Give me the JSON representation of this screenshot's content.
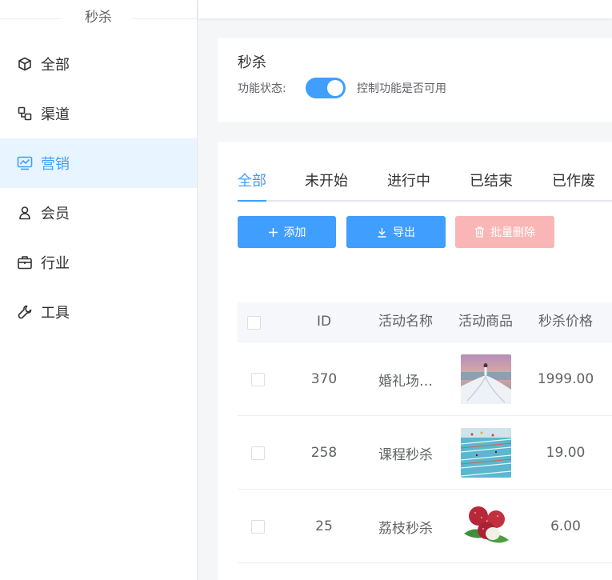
{
  "sidebar": {
    "title": "秒杀",
    "items": [
      {
        "label": "全部",
        "icon": "cube-icon"
      },
      {
        "label": "渠道",
        "icon": "channel-icon"
      },
      {
        "label": "营销",
        "icon": "monitor-chart-icon",
        "active": true
      },
      {
        "label": "会员",
        "icon": "user-icon"
      },
      {
        "label": "行业",
        "icon": "briefcase-icon"
      },
      {
        "label": "工具",
        "icon": "wrench-icon"
      }
    ]
  },
  "switch_card": {
    "title": "秒杀",
    "status_label": "功能状态:",
    "enabled": true,
    "description": "控制功能是否可用"
  },
  "tabs": [
    "全部",
    "未开始",
    "进行中",
    "已结束",
    "已作废"
  ],
  "active_tab": "全部",
  "buttons": {
    "add": "添加",
    "export": "导出",
    "batch_delete": "批量删除"
  },
  "table": {
    "columns": [
      "ID",
      "活动名称",
      "活动商品",
      "秒杀价格"
    ],
    "rows": [
      {
        "id": "370",
        "name": "婚礼场…",
        "goods_image": "wedding-dress-photo",
        "price": "1999.00"
      },
      {
        "id": "258",
        "name": "课程秒杀",
        "goods_image": "swimming-pool-photo",
        "price": "19.00"
      },
      {
        "id": "25",
        "name": "荔枝秒杀",
        "goods_image": "lychee-photo",
        "price": "6.00"
      }
    ]
  },
  "colors": {
    "primary": "#409eff",
    "danger_disabled": "#fab6b6",
    "active_bg": "#e8f4ff"
  }
}
